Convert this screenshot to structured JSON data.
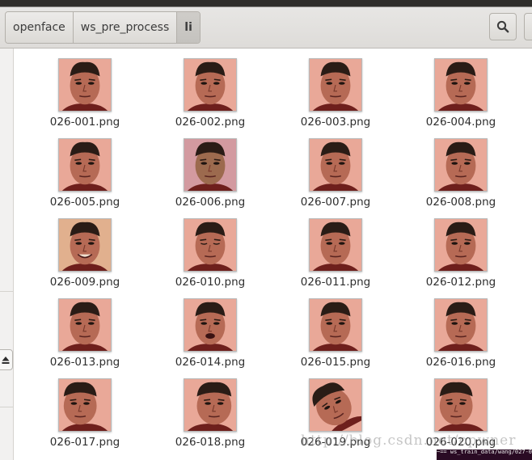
{
  "breadcrumb": {
    "items": [
      {
        "label": "openface"
      },
      {
        "label": "ws_pre_process"
      },
      {
        "label": "li"
      }
    ]
  },
  "toolbar": {
    "search_icon": "search-icon"
  },
  "files": [
    {
      "name": "026-001.png",
      "variant": "front"
    },
    {
      "name": "026-002.png",
      "variant": "front"
    },
    {
      "name": "026-003.png",
      "variant": "front"
    },
    {
      "name": "026-004.png",
      "variant": "front"
    },
    {
      "name": "026-005.png",
      "variant": "front"
    },
    {
      "name": "026-006.png",
      "variant": "greenish"
    },
    {
      "name": "026-007.png",
      "variant": "front"
    },
    {
      "name": "026-008.png",
      "variant": "front"
    },
    {
      "name": "026-009.png",
      "variant": "smile"
    },
    {
      "name": "026-010.png",
      "variant": "eyes-closed"
    },
    {
      "name": "026-011.png",
      "variant": "front"
    },
    {
      "name": "026-012.png",
      "variant": "front"
    },
    {
      "name": "026-013.png",
      "variant": "front"
    },
    {
      "name": "026-014.png",
      "variant": "open-mouth"
    },
    {
      "name": "026-015.png",
      "variant": "front"
    },
    {
      "name": "026-016.png",
      "variant": "front"
    },
    {
      "name": "026-017.png",
      "variant": "turn-left"
    },
    {
      "name": "026-018.png",
      "variant": "turn-right"
    },
    {
      "name": "026-019.png",
      "variant": "tilted"
    },
    {
      "name": "026-020.png",
      "variant": "turn-left"
    }
  ],
  "watermark": "http://blog.csdn.net/opwner",
  "terminal_text": "~== ws_train_data/wang/027-016.jp",
  "colors": {
    "header_bg": "#dedcd9",
    "skin": "#b66a55",
    "background_skin": "#e9a898",
    "hair": "#2a1c16",
    "shirt": "#6e1f1c"
  }
}
